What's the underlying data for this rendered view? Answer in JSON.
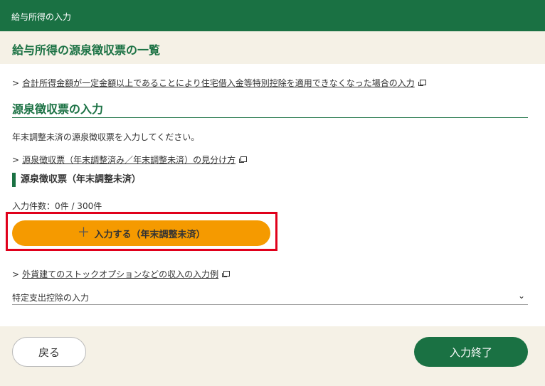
{
  "header": {
    "title": "給与所得の入力"
  },
  "page": {
    "title": "給与所得の源泉徴収票の一覧"
  },
  "links": {
    "housing_loan": "合計所得金額が一定金額以上であることにより住宅借入金等特別控除を適用できなくなった場合の入力",
    "distinguish": "源泉徴収票（年末調整済み／年末調整未済）の見分け方",
    "stock_option": "外貨建てのストックオプションなどの収入の入力例"
  },
  "section": {
    "title": "源泉徴収票の入力",
    "description": "年末調整未済の源泉徴収票を入力してください。",
    "subheading": "源泉徴収票（年末調整未済）",
    "count_label": "入力件数：0件 / 300件",
    "input_button": "入力する（年末調整未済）"
  },
  "accordion": {
    "label": "特定支出控除の入力"
  },
  "footer": {
    "back_label": "戻る",
    "done_label": "入力終了"
  },
  "icons": {
    "chevron": "chevron-right-icon",
    "external": "external-link-icon",
    "plus": "plus-icon",
    "expand": "chevron-down-icon"
  },
  "colors": {
    "brand_green": "#1a7143",
    "accent_orange": "#f59a00",
    "highlight_red": "#e0001b",
    "band_beige": "#f5f1e6"
  }
}
